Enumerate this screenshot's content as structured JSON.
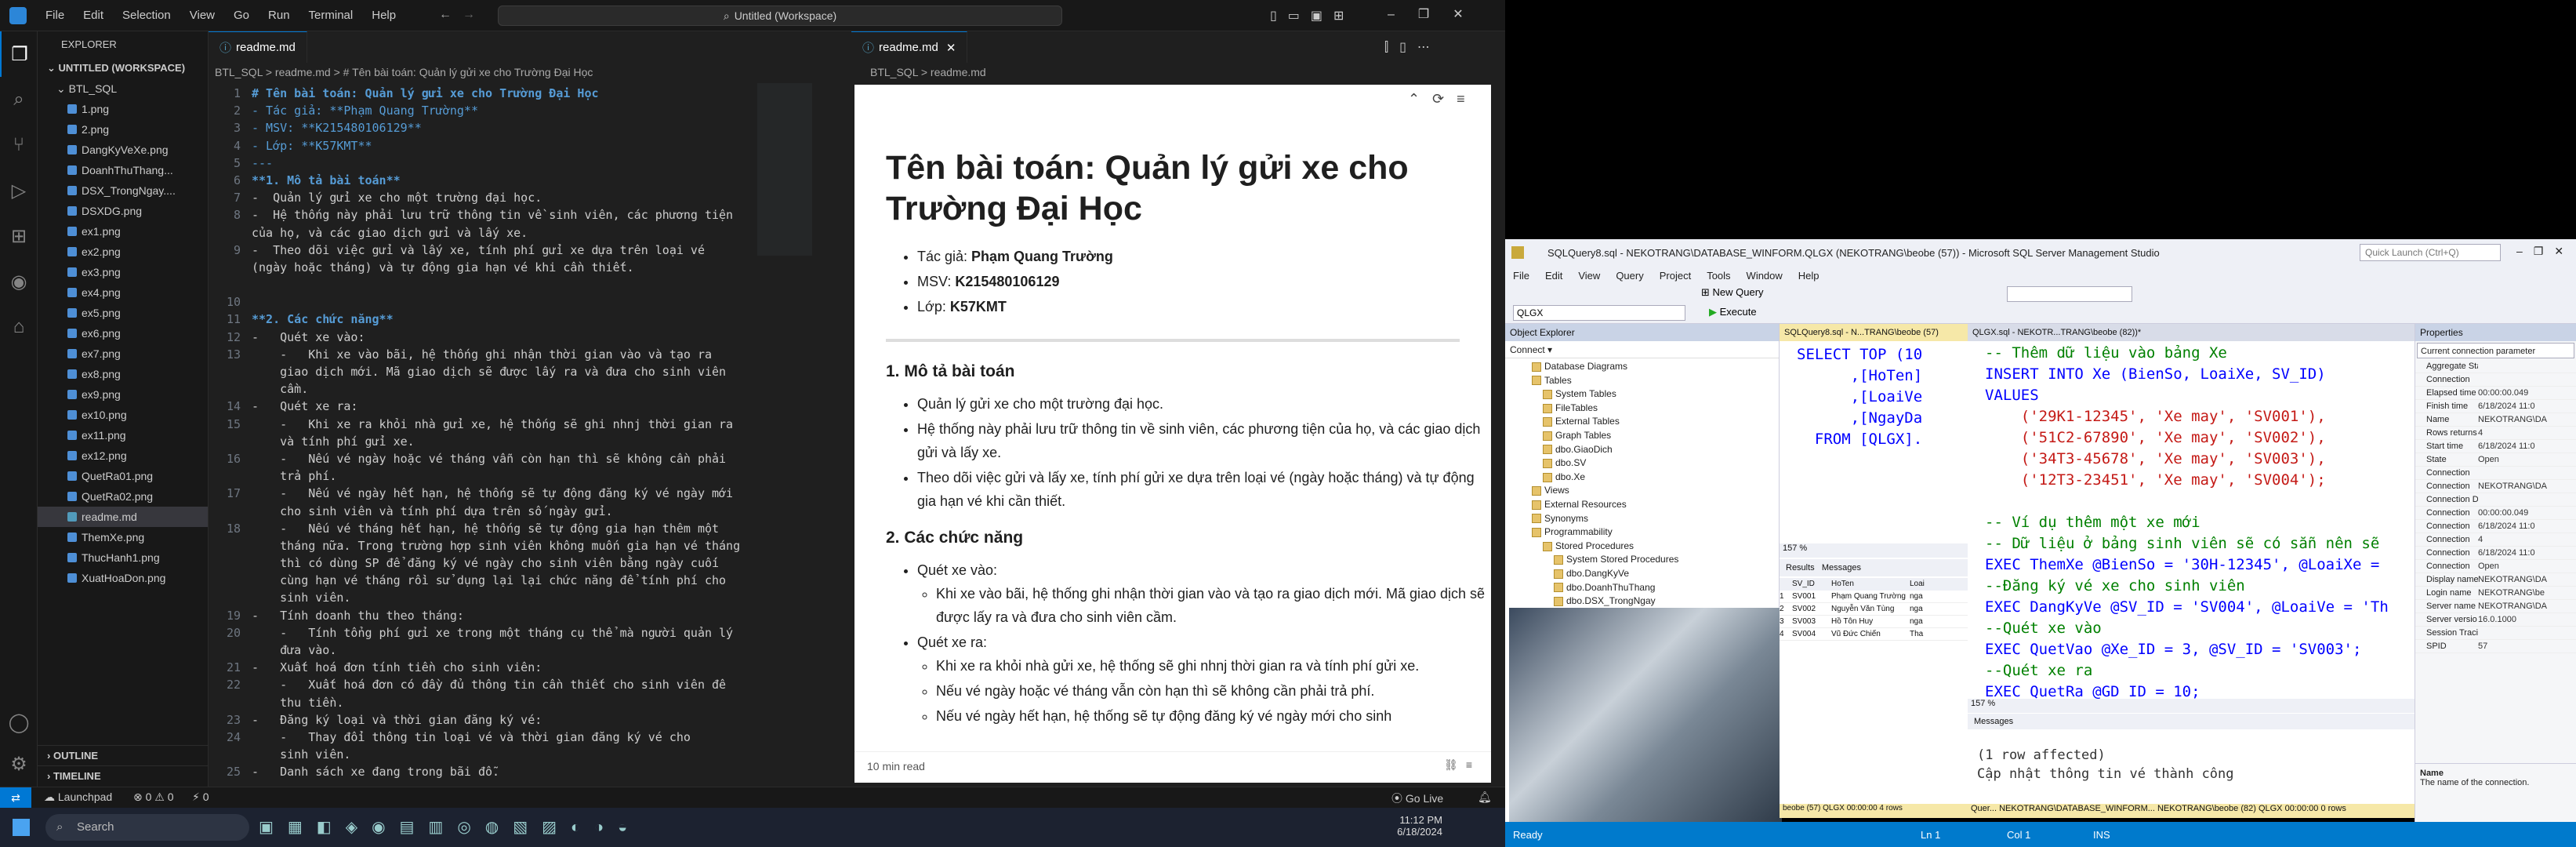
{
  "vscode": {
    "menu": [
      "File",
      "Edit",
      "Selection",
      "View",
      "Go",
      "Run",
      "Terminal",
      "Help"
    ],
    "search": "Untitled (Workspace)",
    "explorer_title": "EXPLORER",
    "workspace": "UNTITLED (WORKSPACE)",
    "folder": "BTL_SQL",
    "files": [
      "1.png",
      "2.png",
      "DangKyVeXe.png",
      "DoanhThuThang...",
      "DSX_TrongNgay....",
      "DSXDG.png",
      "ex1.png",
      "ex2.png",
      "ex3.png",
      "ex4.png",
      "ex5.png",
      "ex6.png",
      "ex7.png",
      "ex8.png",
      "ex9.png",
      "ex10.png",
      "ex11.png",
      "ex12.png",
      "QuetRa01.png",
      "QuetRa02.png",
      "readme.md",
      "ThemXe.png",
      "ThucHanh1.png",
      "XuatHoaDon.png"
    ],
    "outline": "OUTLINE",
    "timeline": "TIMELINE",
    "tab_left": "readme.md",
    "tab_right": "readme.md",
    "breadcrumb_left": "BTL_SQL  >  readme.md  >  # Tên bài toán: Quản lý gửi xe cho Trường Đại Học",
    "breadcrumb_right": "BTL_SQL  >  readme.md",
    "code": [
      {
        "n": "1",
        "t": "# Tên bài toán: Quản lý gửi xe cho Trường Đại Học",
        "c": "h"
      },
      {
        "n": "2",
        "t": "- Tác giả: **Phạm Quang Trường**",
        "c": "b"
      },
      {
        "n": "3",
        "t": "- MSV: **K215480106129**",
        "c": "b"
      },
      {
        "n": "4",
        "t": "- Lớp: **K57KMT**",
        "c": "b"
      },
      {
        "n": "5",
        "t": "---",
        "c": "b"
      },
      {
        "n": "6",
        "t": "**1. Mô tả bài toán**",
        "c": "h"
      },
      {
        "n": "7",
        "t": "-  Quản lý gửi xe cho một trường đại học.",
        "c": ""
      },
      {
        "n": "8",
        "t": "-  Hệ thống này phải lưu trữ thông tin về sinh viên, các phương tiện",
        "c": ""
      },
      {
        "n": "",
        "t": "của họ, và các giao dịch gửi và lấy xe.",
        "c": ""
      },
      {
        "n": "9",
        "t": "-  Theo dõi việc gửi và lấy xe, tính phí gửi xe dựa trên loại vé",
        "c": ""
      },
      {
        "n": "",
        "t": "(ngày hoặc tháng) và tự động gia hạn vé khi cần thiết.",
        "c": ""
      },
      {
        "n": "",
        "t": "",
        "c": ""
      },
      {
        "n": "10",
        "t": "",
        "c": ""
      },
      {
        "n": "11",
        "t": "**2. Các chức năng**",
        "c": "h"
      },
      {
        "n": "12",
        "t": "-   Quét xe vào:",
        "c": ""
      },
      {
        "n": "13",
        "t": "    -   Khi xe vào bãi, hệ thống ghi nhận thời gian vào và tạo ra",
        "c": ""
      },
      {
        "n": "",
        "t": "    giao dịch mới. Mã giao dịch sẽ được lấy ra và đưa cho sinh viên",
        "c": ""
      },
      {
        "n": "",
        "t": "    cầm.",
        "c": ""
      },
      {
        "n": "14",
        "t": "-   Quét xe ra:",
        "c": ""
      },
      {
        "n": "15",
        "t": "    -   Khi xe ra khỏi nhà gửi xe, hệ thống sẽ ghi nhnj thời gian ra",
        "c": ""
      },
      {
        "n": "",
        "t": "    và tính phí gửi xe.",
        "c": ""
      },
      {
        "n": "16",
        "t": "    -   Nếu vé ngày hoặc vé tháng vẫn còn hạn thì sẽ không cần phải",
        "c": ""
      },
      {
        "n": "",
        "t": "    trả phí.",
        "c": ""
      },
      {
        "n": "17",
        "t": "    -   Nếu vé ngày hết hạn, hệ thống sẽ tự động đăng ký vé ngày mới",
        "c": ""
      },
      {
        "n": "",
        "t": "    cho sinh viên và tính phí dựa trên số ngày gửi.",
        "c": ""
      },
      {
        "n": "18",
        "t": "    -   Nếu vé tháng hết hạn, hệ thống sẽ tự động gia hạn thêm một",
        "c": ""
      },
      {
        "n": "",
        "t": "    tháng nữa. Trong trường hợp sinh viên không muốn gia hạn vé tháng",
        "c": ""
      },
      {
        "n": "",
        "t": "    thì có dùng SP để đăng ký vé ngày cho sinh viên bằng ngày cuối",
        "c": ""
      },
      {
        "n": "",
        "t": "    cùng hạn vé tháng rồi sử dụng lại lại chức năng để tính phí cho",
        "c": ""
      },
      {
        "n": "",
        "t": "    sinh viên.",
        "c": ""
      },
      {
        "n": "19",
        "t": "-   Tính doanh thu theo tháng:",
        "c": ""
      },
      {
        "n": "20",
        "t": "    -   Tính tổng phí gửi xe trong một tháng cụ thể mà người quản lý",
        "c": ""
      },
      {
        "n": "",
        "t": "    đưa vào.",
        "c": ""
      },
      {
        "n": "21",
        "t": "-   Xuất hoá đơn tính tiền cho sinh viên:",
        "c": ""
      },
      {
        "n": "22",
        "t": "    -   Xuất hoá đơn có đầy đủ thông tin cần thiết cho sinh viên để",
        "c": ""
      },
      {
        "n": "",
        "t": "    thu tiền.",
        "c": ""
      },
      {
        "n": "23",
        "t": "-   Đăng ký loại và thời gian đăng ký vé:",
        "c": ""
      },
      {
        "n": "24",
        "t": "    -   Thay đổi thông tin loại vé và thời gian đăng ký vé cho",
        "c": ""
      },
      {
        "n": "",
        "t": "    sinh viên.",
        "c": ""
      },
      {
        "n": "25",
        "t": "-   Danh sách xe đang trong bãi đỗ.",
        "c": ""
      }
    ],
    "preview": {
      "h1": "Tên bài toán: Quản lý gửi xe cho Trường Đại Học",
      "author_label": "Tác giả: ",
      "author": "Phạm Quang Trường",
      "msv_label": "MSV: ",
      "msv": "K215480106129",
      "lop_label": "Lớp: ",
      "lop": "K57KMT",
      "h2a": "1. Mô tả bài toán",
      "p1": [
        "Quản lý gửi xe cho một trường đại học.",
        "Hệ thống này phải lưu trữ thông tin về sinh viên, các phương tiện của họ, và các giao dịch gửi và lấy xe.",
        "Theo dõi việc gửi và lấy xe, tính phí gửi xe dựa trên loại vé (ngày hoặc tháng) và tự động gia hạn vé khi cần thiết."
      ],
      "h2b": "2. Các chức năng",
      "q_in": "Quét xe vào:",
      "q_in_1": "Khi xe vào bãi, hệ thống ghi nhận thời gian vào và tạo ra giao dịch mới. Mã giao dịch sẽ được lấy ra và đưa cho sinh viên cầm.",
      "q_out": "Quét xe ra:",
      "q_out_1": "Khi xe ra khỏi nhà gửi xe, hệ thống sẽ ghi nhnj thời gian ra và tính phí gửi xe.",
      "q_out_2": "Nếu vé ngày hoặc vé tháng vẫn còn hạn thì sẽ không cần phải trả phí.",
      "q_out_3": "Nếu vé ngày hết hạn, hệ thống sẽ tự động đăng ký vé ngày mới cho sinh",
      "read_time": "10 min read"
    },
    "status": {
      "launchpad": "Launchpad",
      "problems": "⊗ 0 ⚠ 0",
      "ports": "⚡ 0",
      "golive": "Go Live"
    },
    "taskbar": {
      "search": "Search",
      "time": "11:12 PM",
      "date": "6/18/2024"
    }
  },
  "ssms": {
    "title": "SQLQuery8.sql - NEKOTRANG\\DATABASE_WINFORM.QLGX (NEKOTRANG\\beobe (57)) - Microsoft SQL Server Management Studio",
    "quick_launch": "Quick Launch (Ctrl+Q)",
    "menu": [
      "File",
      "Edit",
      "View",
      "Query",
      "Project",
      "Tools",
      "Window",
      "Help"
    ],
    "new_query": "New Query",
    "execute": "Execute",
    "db": "QLGX",
    "object_explorer": "Object Explorer",
    "connect": "Connect ▾",
    "tree": [
      {
        "t": "Database Diagrams",
        "i": 1
      },
      {
        "t": "Tables",
        "i": 1
      },
      {
        "t": "System Tables",
        "i": 2
      },
      {
        "t": "FileTables",
        "i": 2
      },
      {
        "t": "External Tables",
        "i": 2
      },
      {
        "t": "Graph Tables",
        "i": 2
      },
      {
        "t": "dbo.GiaoDich",
        "i": 2
      },
      {
        "t": "dbo.SV",
        "i": 2
      },
      {
        "t": "dbo.Xe",
        "i": 2
      },
      {
        "t": "Views",
        "i": 1
      },
      {
        "t": "External Resources",
        "i": 1
      },
      {
        "t": "Synonyms",
        "i": 1
      },
      {
        "t": "Programmability",
        "i": 1
      },
      {
        "t": "Stored Procedures",
        "i": 2
      },
      {
        "t": "System Stored Procedures",
        "i": 3
      },
      {
        "t": "dbo.DangKyVe",
        "i": 3
      },
      {
        "t": "dbo.DoanhThuThang",
        "i": 3
      },
      {
        "t": "dbo.DSX_TrongNgay",
        "i": 3
      },
      {
        "t": "dbo.DSXDG",
        "i": 3
      }
    ],
    "tab1": "SQLQuery8.sql - N...TRANG\\beobe (57)",
    "tab2": "QLGX.sql - NEKOTR...TRANG\\beobe (82))*",
    "q1_lines": [
      "SELECT TOP (10",
      "      ,[HoTen]",
      "      ,[LoaiVe",
      "      ,[NgayDa",
      "  FROM [QLGX]."
    ],
    "zoom": "157 %",
    "results_tab": "Results",
    "messages_tab": "Messages",
    "grid_head": [
      "SV_ID",
      "HoTen",
      "Loai"
    ],
    "grid": [
      [
        "1",
        "SV001",
        "Phạm Quang Trường",
        "nga"
      ],
      [
        "2",
        "SV002",
        "Nguyễn Văn Tùng",
        "nga"
      ],
      [
        "3",
        "SV003",
        "Hồ Tôn Huy",
        "nga"
      ],
      [
        "4",
        "SV004",
        "Vũ Đức Chiến",
        "Tha"
      ]
    ],
    "q2_lines": [
      {
        "c": "cm",
        "t": "-- Thêm dữ liệu vào bảng Xe"
      },
      {
        "c": "kw",
        "t": "INSERT INTO Xe (BienSo, LoaiXe, SV_ID)"
      },
      {
        "c": "kw",
        "t": "VALUES"
      },
      {
        "c": "str",
        "t": "    ('29K1-12345', 'Xe may', 'SV001'),"
      },
      {
        "c": "str",
        "t": "    ('51C2-67890', 'Xe may', 'SV002'),"
      },
      {
        "c": "str",
        "t": "    ('34T3-45678', 'Xe may', 'SV003'),"
      },
      {
        "c": "str",
        "t": "    ('12T3-23451', 'Xe may', 'SV004');"
      },
      {
        "c": "",
        "t": ""
      },
      {
        "c": "cm",
        "t": "-- Ví dụ thêm một xe mới"
      },
      {
        "c": "cm",
        "t": "-- Dữ liệu ở bảng sinh viên sẽ có sẵn nên sẽ"
      },
      {
        "c": "kw",
        "t": "EXEC ThemXe @BienSo = '30H-12345', @LoaiXe ="
      },
      {
        "c": "cm",
        "t": "--Đăng ký vé xe cho sinh viên"
      },
      {
        "c": "kw",
        "t": "EXEC DangKyVe @SV_ID = 'SV004', @LoaiVe = 'Th"
      },
      {
        "c": "cm",
        "t": "--Quét xe vào"
      },
      {
        "c": "kw",
        "t": "EXEC QuetVao @Xe_ID = 3, @SV_ID = 'SV003';"
      },
      {
        "c": "cm",
        "t": "--Quét xe ra"
      },
      {
        "c": "kw",
        "t": "EXEC QuetRa @GD_ID = 10;"
      }
    ],
    "zoom2": "157 %",
    "messages": "Messages",
    "msg_lines": [
      "(1 row affected)",
      "Cập nhật thông tin vé thành công"
    ],
    "properties": "Properties",
    "prop_sel": "Current connection parameter",
    "props": [
      [
        "Aggregate Status",
        ""
      ],
      [
        "Connection",
        ""
      ],
      [
        "Elapsed time",
        "00:00:00.049"
      ],
      [
        "Finish time",
        "6/18/2024 11:0"
      ],
      [
        "Name",
        "NEKOTRANG\\DA"
      ],
      [
        "Rows returns",
        "4"
      ],
      [
        "Start time",
        "6/18/2024 11:0"
      ],
      [
        "State",
        "Open"
      ],
      [
        "Connection",
        ""
      ],
      [
        "Connection",
        "NEKOTRANG\\DA"
      ],
      [
        "Connection Details",
        ""
      ],
      [
        "Connection",
        "00:00:00.049"
      ],
      [
        "Connection",
        "6/18/2024 11:0"
      ],
      [
        "Connection",
        "4"
      ],
      [
        "Connection",
        "6/18/2024 11:0"
      ],
      [
        "Connection",
        "Open"
      ],
      [
        "Display name",
        "NEKOTRANG\\DA"
      ],
      [
        "Login name",
        "NEKOTRANG\\be"
      ],
      [
        "Server name",
        "NEKOTRANG\\DA"
      ],
      [
        "Server versio",
        "16.0.1000"
      ],
      [
        "Session Traci",
        ""
      ],
      [
        "SPID",
        "57"
      ]
    ],
    "prop_desc_title": "Name",
    "prop_desc": "The name of the connection.",
    "status_bar": [
      "beobe (57)",
      "QLGX",
      "00:00:00",
      "4 rows"
    ],
    "status_bar2": [
      "Quer...",
      "NEKOTRANG\\DATABASE_WINFORM...",
      "NEKOTRANG\\beobe (82)",
      "QLGX",
      "00:00:00",
      "0 rows"
    ],
    "ready": "Ready",
    "ln": "Ln 1",
    "col": "Col 1",
    "ins": "INS"
  }
}
